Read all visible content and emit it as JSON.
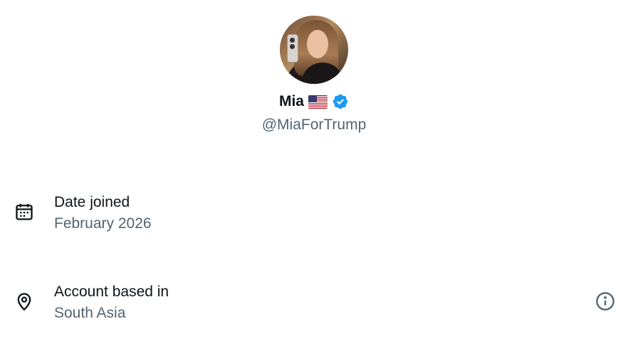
{
  "profile": {
    "display_name": "Mia",
    "flag_icon": "us-flag-icon",
    "verified_icon": "verified-badge-icon",
    "verified_color": "#1d9bf0",
    "handle": "@MiaForTrump"
  },
  "rows": [
    {
      "icon": "calendar-icon",
      "label": "Date joined",
      "value": "February 2026"
    },
    {
      "icon": "location-pin-icon",
      "label": "Account based in",
      "value": "South Asia",
      "action_icon": "info-icon"
    }
  ],
  "colors": {
    "text_primary": "#0f1419",
    "text_secondary": "#536471",
    "background": "#ffffff"
  }
}
